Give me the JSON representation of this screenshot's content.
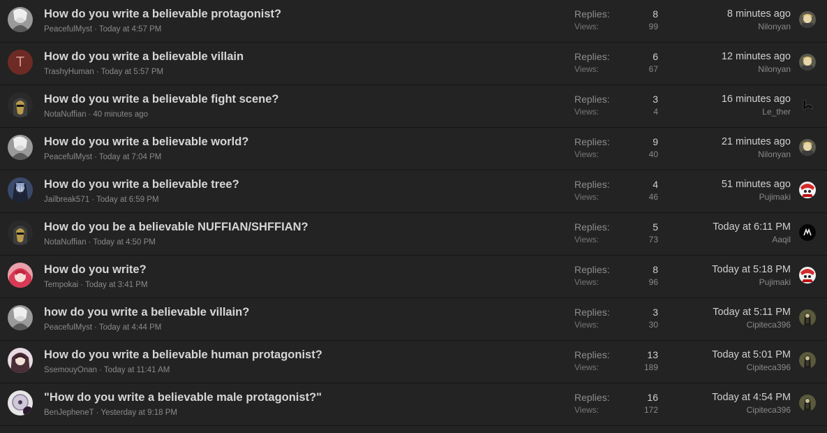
{
  "threads": [
    {
      "title": "How do you write a believable protagonist?",
      "author": "PeacefulMyst",
      "date": "Today at 4:57 PM",
      "replies_label": "Replies:",
      "replies": "8",
      "views_label": "Views:",
      "views": "99",
      "latest_time": "8 minutes ago",
      "latest_user": "Nilonyan",
      "avatar_icon": "grey-portrait-avatar",
      "latest_avatar_icon": "blonde-character-avatar"
    },
    {
      "title": "How do you write a believable villain",
      "author": "TrashyHuman",
      "date": "Today at 5:57 PM",
      "replies_label": "Replies:",
      "replies": "6",
      "views_label": "Views:",
      "views": "67",
      "latest_time": "12 minutes ago",
      "latest_user": "Nilonyan",
      "avatar_letter": "T",
      "latest_avatar_icon": "blonde-character-avatar"
    },
    {
      "title": "How do you write a believable fight scene?",
      "author": "NotaNuffian",
      "date": "40 minutes ago",
      "replies_label": "Replies:",
      "replies": "3",
      "views_label": "Views:",
      "views": "4",
      "latest_time": "16 minutes ago",
      "latest_user": "Le_ther",
      "avatar_icon": "masked-knight-avatar",
      "latest_avatar_icon": "ink-brush-avatar"
    },
    {
      "title": "How do you write a believable world?",
      "author": "PeacefulMyst",
      "date": "Today at 7:04 PM",
      "replies_label": "Replies:",
      "replies": "9",
      "views_label": "Views:",
      "views": "40",
      "latest_time": "21 minutes ago",
      "latest_user": "Nilonyan",
      "avatar_icon": "grey-portrait-avatar",
      "latest_avatar_icon": "blonde-character-avatar"
    },
    {
      "title": "How do you write a believable tree?",
      "author": "Jailbreak571",
      "date": "Today at 6:59 PM",
      "replies_label": "Replies:",
      "replies": "4",
      "views_label": "Views:",
      "views": "46",
      "latest_time": "51 minutes ago",
      "latest_user": "Pujimaki",
      "avatar_icon": "blue-character-avatar",
      "latest_avatar_icon": "red-white-character-avatar"
    },
    {
      "title": "How do you be a believable NUFFIAN/SHFFIAN?",
      "author": "NotaNuffian",
      "date": "Today at 4:50 PM",
      "replies_label": "Replies:",
      "replies": "5",
      "views_label": "Views:",
      "views": "73",
      "latest_time": "Today at 6:11 PM",
      "latest_user": "Aaqil",
      "avatar_icon": "masked-knight-avatar",
      "latest_avatar_icon": "black-emblem-avatar"
    },
    {
      "title": "How do you write?",
      "author": "Tempokai",
      "date": "Today at 3:41 PM",
      "replies_label": "Replies:",
      "replies": "8",
      "views_label": "Views:",
      "views": "96",
      "latest_time": "Today at 5:18 PM",
      "latest_user": "Pujimaki",
      "avatar_icon": "pink-character-avatar",
      "latest_avatar_icon": "red-white-character-avatar"
    },
    {
      "title": "how do you write a believable villain?",
      "author": "PeacefulMyst",
      "date": "Today at 4:44 PM",
      "replies_label": "Replies:",
      "replies": "3",
      "views_label": "Views:",
      "views": "30",
      "latest_time": "Today at 5:11 PM",
      "latest_user": "Cipiteca396",
      "avatar_icon": "grey-portrait-avatar",
      "latest_avatar_icon": "dark-figure-avatar"
    },
    {
      "title": "How do you write a believable human protagonist?",
      "author": "SsemouyOnan",
      "date": "Today at 11:41 AM",
      "replies_label": "Replies:",
      "replies": "13",
      "views_label": "Views:",
      "views": "189",
      "latest_time": "Today at 5:01 PM",
      "latest_user": "Cipiteca396",
      "avatar_icon": "anime-girl-avatar",
      "latest_avatar_icon": "dark-figure-avatar"
    },
    {
      "title": "\"How do you write a believable male protagonist?\"",
      "author": "BenJepheneT",
      "date": "Yesterday at 9:18 PM",
      "replies_label": "Replies:",
      "replies": "16",
      "views_label": "Views:",
      "views": "172",
      "latest_time": "Today at 4:54 PM",
      "latest_user": "Cipiteca396",
      "avatar_icon": "disc-avatar",
      "latest_avatar_icon": "dark-figure-avatar"
    }
  ],
  "colors": {
    "background": "#232323",
    "divider": "#161616",
    "title": "#d6d6d6",
    "muted": "#8a8a8a",
    "letter_avatar_bg": "#6e2a24",
    "letter_avatar_fg": "#d49a8e"
  }
}
